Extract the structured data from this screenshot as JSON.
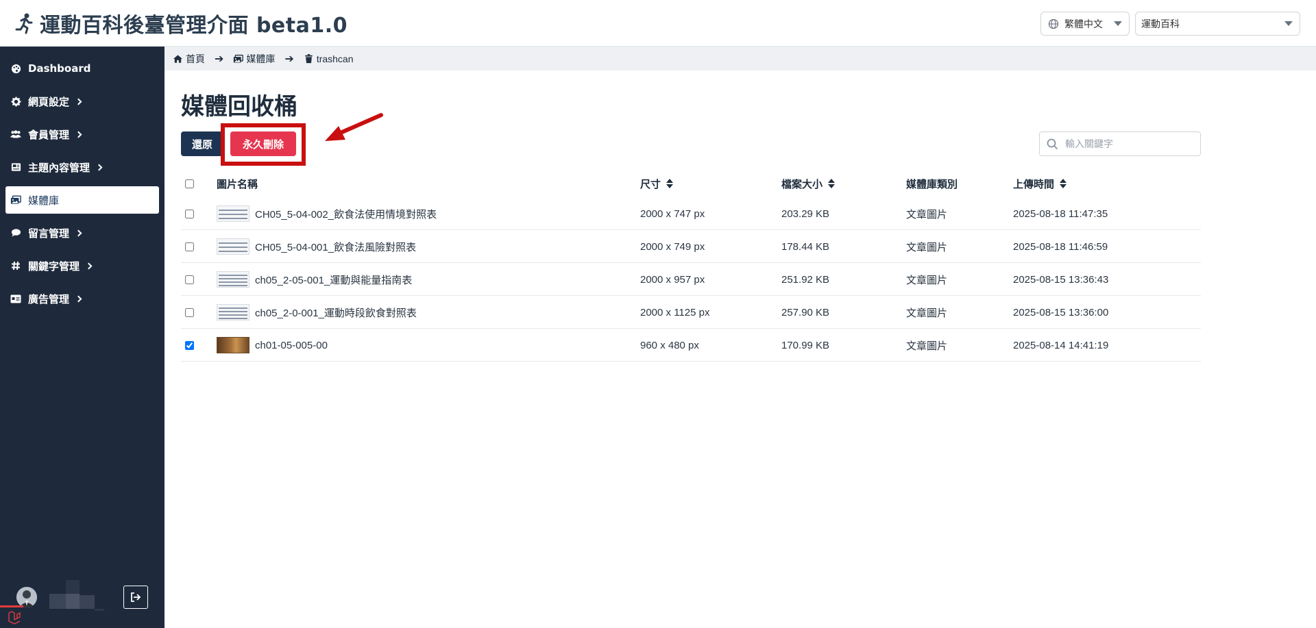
{
  "header": {
    "title": "運動百科後臺管理介面 beta1.0",
    "language": "繁體中文",
    "site": "運動百科"
  },
  "sidebar": {
    "items": [
      {
        "label": "Dashboard",
        "icon": "palette-icon",
        "has_children": false,
        "active": false
      },
      {
        "label": "網頁設定",
        "icon": "gear-icon",
        "has_children": true,
        "active": false
      },
      {
        "label": "會員管理",
        "icon": "users-icon",
        "has_children": true,
        "active": false
      },
      {
        "label": "主題內容管理",
        "icon": "newspaper-icon",
        "has_children": true,
        "active": false
      },
      {
        "label": "媒體庫",
        "icon": "images-icon",
        "has_children": false,
        "active": true
      },
      {
        "label": "留言管理",
        "icon": "comment-icon",
        "has_children": true,
        "active": false
      },
      {
        "label": "關鍵字管理",
        "icon": "hashtag-icon",
        "has_children": true,
        "active": false
      },
      {
        "label": "廣告管理",
        "icon": "ad-icon",
        "has_children": true,
        "active": false
      }
    ]
  },
  "breadcrumb": {
    "home": "首頁",
    "media": "媒體庫",
    "current": "trashcan"
  },
  "page": {
    "title": "媒體回收桶",
    "restore_label": "還原",
    "delete_label": "永久刪除",
    "search_placeholder": "輸入關鍵字"
  },
  "table": {
    "headers": {
      "name": "圖片名稱",
      "size": "尺寸",
      "filesize": "檔案大小",
      "category": "媒體庫類別",
      "uploaded": "上傳時間"
    },
    "rows": [
      {
        "name": "CH05_5-04-002_飲食法使用情境對照表",
        "dims": "2000 x 747 px",
        "filesize": "203.29 KB",
        "category": "文章圖片",
        "uploaded": "2025-08-18 11:47:35",
        "checked": false,
        "thumb": "table"
      },
      {
        "name": "CH05_5-04-001_飲食法風險對照表",
        "dims": "2000 x 749 px",
        "filesize": "178.44 KB",
        "category": "文章圖片",
        "uploaded": "2025-08-18 11:46:59",
        "checked": false,
        "thumb": "table"
      },
      {
        "name": "ch05_2-05-001_運動與能量指南表",
        "dims": "2000 x 957 px",
        "filesize": "251.92 KB",
        "category": "文章圖片",
        "uploaded": "2025-08-15 13:36:43",
        "checked": false,
        "thumb": "table"
      },
      {
        "name": "ch05_2-0-001_運動時段飲食對照表",
        "dims": "2000 x 1125 px",
        "filesize": "257.90 KB",
        "category": "文章圖片",
        "uploaded": "2025-08-15 13:36:00",
        "checked": false,
        "thumb": "table"
      },
      {
        "name": "ch01-05-005-00",
        "dims": "960 x 480 px",
        "filesize": "170.99 KB",
        "category": "文章圖片",
        "uploaded": "2025-08-14 14:41:19",
        "checked": true,
        "thumb": "photo"
      }
    ]
  },
  "colors": {
    "sidebar_bg": "#1e2a3c",
    "restore_btn": "#1c3452",
    "delete_btn": "#e6364f",
    "annotation": "#c90f0f"
  }
}
